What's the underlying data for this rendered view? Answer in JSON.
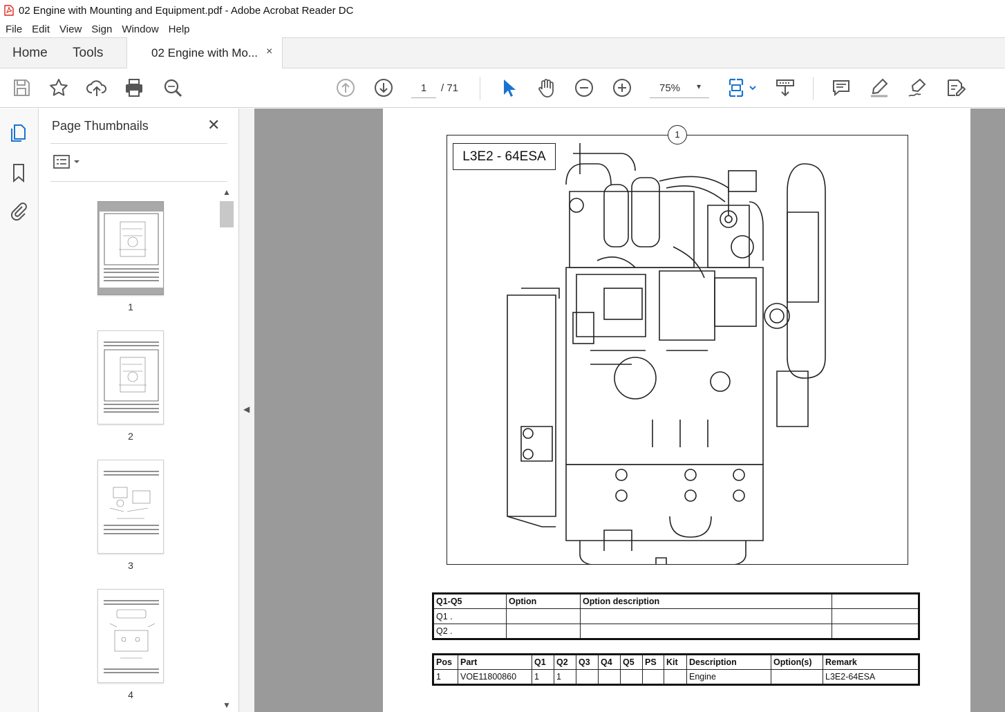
{
  "window": {
    "title": "02 Engine with Mounting and Equipment.pdf - Adobe Acrobat Reader DC"
  },
  "menu": [
    "File",
    "Edit",
    "View",
    "Sign",
    "Window",
    "Help"
  ],
  "tabs": {
    "home": "Home",
    "tools": "Tools",
    "document": "02 Engine with Mo...",
    "close": "×"
  },
  "toolbar": {
    "page_current": "1",
    "page_total": "/ 71",
    "zoom": "75%",
    "zoom_caret": "▾"
  },
  "panel": {
    "title": "Page Thumbnails",
    "close": "✕",
    "scroll_up": "▲",
    "scroll_down": "▼",
    "collapse": "◀",
    "thumbnails": [
      {
        "label": "1",
        "selected": true
      },
      {
        "label": "2",
        "selected": false
      },
      {
        "label": "3",
        "selected": false
      },
      {
        "label": "4",
        "selected": false
      }
    ]
  },
  "document": {
    "position_marker": "1",
    "model_label": "L3E2 - 64ESA",
    "options_table": {
      "headers": [
        "Q1-Q5",
        "Option",
        "Option description",
        ""
      ],
      "rows": [
        [
          "Q1 .",
          "",
          "",
          ""
        ],
        [
          "Q2 .",
          "",
          "",
          ""
        ]
      ]
    },
    "parts_table": {
      "headers": [
        "Pos",
        "Part",
        "Q1",
        "Q2",
        "Q3",
        "Q4",
        "Q5",
        "PS",
        "Kit",
        "Description",
        "Option(s)",
        "Remark"
      ],
      "rows": [
        [
          "1",
          "VOE11800860",
          "1",
          "1",
          "",
          "",
          "",
          "",
          "",
          "Engine",
          "",
          "L3E2-64ESA"
        ]
      ]
    }
  },
  "colors": {
    "accent_blue": "#1a73d1",
    "pdf_red": "#e1251b",
    "doc_background": "#9a9a9a"
  },
  "icons": {
    "app": "pdf-icon",
    "save": "save-icon",
    "bookmark_star": "star-icon",
    "upload": "upload-cloud-icon",
    "print": "print-icon",
    "search": "zoom-search-icon",
    "prev_page": "arrow-up-circle-icon",
    "next_page": "arrow-down-circle-icon",
    "select": "pointer-icon",
    "hand": "hand-icon",
    "zoom_out": "minus-circle-icon",
    "zoom_in": "plus-circle-icon",
    "fit": "fit-page-icon",
    "scroll_mode": "scroll-mode-icon",
    "comment": "comment-icon",
    "highlight": "highlight-pen-icon",
    "sign": "sign-pen-icon",
    "edit": "edit-doc-icon"
  }
}
